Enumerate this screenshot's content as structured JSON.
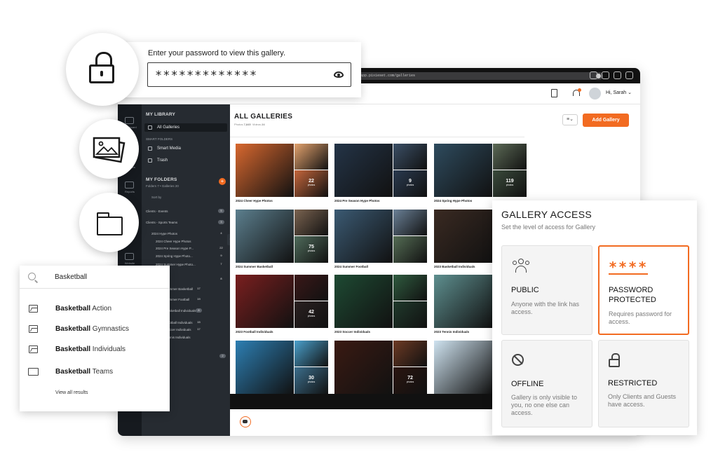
{
  "browser": {
    "url": "app.pixieset.com/galleries"
  },
  "header": {
    "user_greeting": "Hi, Sarah"
  },
  "library": {
    "title": "MY LIBRARY",
    "all_galleries": "All Galleries",
    "smart_folders_label": "SMART FOLDERS",
    "smart_media": "Smart Media",
    "trash": "Trash",
    "my_folders_title": "MY FOLDERS",
    "my_folders_sub": "Folders 7 • Galleries 20",
    "sort_by": "Sort by",
    "folders": [
      {
        "label": "Clients - Events",
        "count": "5"
      },
      {
        "label": "Clients - Sports Teams",
        "count": "3"
      },
      {
        "label": "2024 Hype Photos",
        "count": "4"
      },
      {
        "label": "2024 Cheer Hype Photos",
        "count": ""
      },
      {
        "label": "2024 Pre Season Hype P...",
        "count": "22"
      },
      {
        "label": "2024 Spring Hype Photo...",
        "count": "9"
      },
      {
        "label": "2024 Summer Hype Photo...",
        "count": "7"
      },
      {
        "label": "",
        "count": "8"
      }
    ],
    "search_folders": [
      {
        "label": "Summer Basketball",
        "count": "17"
      },
      {
        "label": "Summer Football",
        "count": "19"
      },
      {
        "label": "Basketball Individuals",
        "count": "8"
      },
      {
        "label": "Football Individuals",
        "count": "15"
      },
      {
        "label": "Soccer Individuals",
        "count": "17"
      },
      {
        "label": "Tennis Individuals",
        "count": ""
      },
      {
        "label": "",
        "count": "2"
      }
    ]
  },
  "nav": {
    "items": [
      "Dashboard",
      "Galleries",
      "Reports",
      "Website"
    ]
  },
  "main": {
    "title": "ALL GALLERIES",
    "stats_photos_label": "Photos",
    "stats_photos": "7,845",
    "stats_videos_label": "Videos",
    "stats_videos": "24",
    "add_button": "Add Gallery",
    "galleries": [
      {
        "label": "2024 Cheer Hype Photos",
        "more": "22",
        "more_label": "photos",
        "colors": [
          "#d8682f",
          "#e3a26d",
          "#c5663b"
        ]
      },
      {
        "label": "2024 Pre Season Hype Photos",
        "more": "9",
        "more_label": "photos",
        "colors": [
          "#243447",
          "#3b4f66",
          "#2a3a4f"
        ]
      },
      {
        "label": "2024 Spring Hype Photos",
        "more": "119",
        "more_label": "photos",
        "colors": [
          "#2e4b5e",
          "#5c6a56",
          "#3a4a3b"
        ]
      },
      {
        "label": "2024 Summer Basketball",
        "more": "75",
        "more_label": "photos",
        "colors": [
          "#5c7f8e",
          "#7a6350",
          "#4f6b5b"
        ]
      },
      {
        "label": "2024 Summer Football",
        "more": "",
        "more_label": "",
        "colors": [
          "#3b5a73",
          "#6a8096",
          "#556d55"
        ]
      },
      {
        "label": "2023 Basketball Individuals",
        "more": "",
        "more_label": "",
        "colors": [
          "#3a2a22",
          "#5a3a2a",
          "#2b211b"
        ]
      },
      {
        "label": "2023 Football Individuals",
        "more": "42",
        "more_label": "photos",
        "colors": [
          "#7a1f1f",
          "#3a1818",
          "#2a2020"
        ]
      },
      {
        "label": "2023 Soccer Individuals",
        "more": "",
        "more_label": "",
        "colors": [
          "#1e4a33",
          "#2f5b3f",
          "#203a2c"
        ]
      },
      {
        "label": "2023 Tennis Individuals",
        "more": "",
        "more_label": "",
        "colors": [
          "#5e8f8f",
          "#cfd7d3",
          "#8aa6a0"
        ]
      },
      {
        "label": "",
        "more": "30",
        "more_label": "photos",
        "colors": [
          "#2d7fb3",
          "#4aa0cc",
          "#3c6e8c"
        ]
      },
      {
        "label": "",
        "more": "72",
        "more_label": "photos",
        "colors": [
          "#3a1a12",
          "#6d3a24",
          "#2a1510"
        ]
      },
      {
        "label": "",
        "more": "",
        "more_label": "",
        "colors": [
          "#cfe3f0",
          "#8fb4cc",
          "#e6eef4"
        ]
      }
    ]
  },
  "password_prompt": {
    "label": "Enter your password to view this gallery.",
    "value": "*************"
  },
  "search": {
    "value": "Basketball",
    "results": [
      {
        "bold": "Basketball",
        "rest": " Action",
        "icon": "image-icon"
      },
      {
        "bold": "Basketball",
        "rest": " Gymnastics",
        "icon": "image-icon"
      },
      {
        "bold": "Basketball",
        "rest": " Individuals",
        "icon": "image-icon"
      },
      {
        "bold": "Basketball",
        "rest": " Teams",
        "icon": "folder-icon"
      }
    ],
    "view_all": "View all results"
  },
  "access": {
    "title": "GALLERY ACCESS",
    "subtitle": "Set the level of access for Gallery",
    "options": [
      {
        "title": "PUBLIC",
        "desc": "Anyone with the link has access.",
        "selected": false
      },
      {
        "title": "PASSWORD PROTECTED",
        "desc": "Requires password for access.",
        "selected": true,
        "stars": "****"
      },
      {
        "title": "OFFLINE",
        "desc": "Gallery is only visible to you, no one else can access.",
        "selected": false
      },
      {
        "title": "RESTRICTED",
        "desc": "Only Clients and Guests have access.",
        "selected": false
      }
    ]
  },
  "colors": {
    "accent": "#f26b21",
    "sidebar": "#262b31",
    "nav": "#161a1f"
  }
}
